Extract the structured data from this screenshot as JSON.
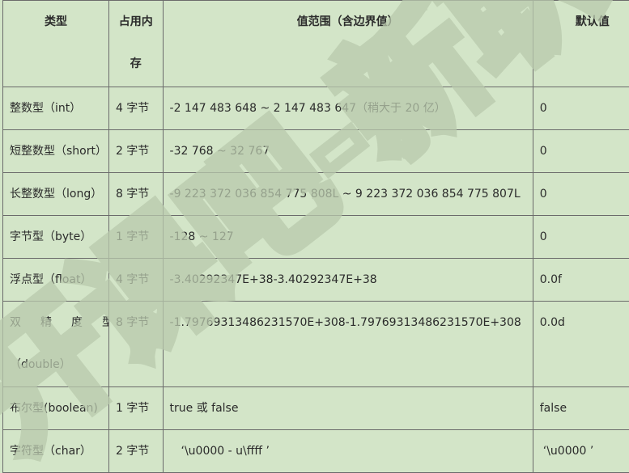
{
  "table": {
    "headers": [
      "类型",
      "占用内存",
      "值范围（含边界值）",
      "默认值"
    ],
    "rows": [
      {
        "type": "整数型（int）",
        "size": "4 字节",
        "range": "-2 147 483 648 ~ 2 147 483 647（稍大于 20 亿）",
        "default": "0"
      },
      {
        "type": "短整数型（short）",
        "size": "2 字节",
        "range": "-32 768 ~ 32 767",
        "default": "0"
      },
      {
        "type": "长整数型（long）",
        "size": "8 字节",
        "range": "-9 223 372 036 854 775 808L ~ 9 223 372 036 854 775 807L",
        "default": "0"
      },
      {
        "type": "字节型（byte）",
        "size": "1 字节",
        "range": "-128 ~ 127",
        "default": "0"
      },
      {
        "type": "浮点型（float）",
        "size": "4 字节",
        "range": "-3.40292347E+38-3.40292347E+38",
        "default": "0.0f"
      },
      {
        "type_line1": "双精度型",
        "type_line2": "（double）",
        "size": "8 字节",
        "range": "-1.79769313486231570E+308-1.79769313486231570E+308",
        "default": "0.0d"
      },
      {
        "type": "布尔型(boolean)",
        "size": "1 字节",
        "range": "true 或 false",
        "default": "false"
      },
      {
        "type": "字符型（char）",
        "size": "2 字节",
        "range": "‘\\u0000 - u\\ffff ’",
        "default": "‘\\u0000 ’"
      }
    ]
  },
  "watermark": {
    "text": "开课吧-新职",
    "color": "#b9c9ad"
  }
}
